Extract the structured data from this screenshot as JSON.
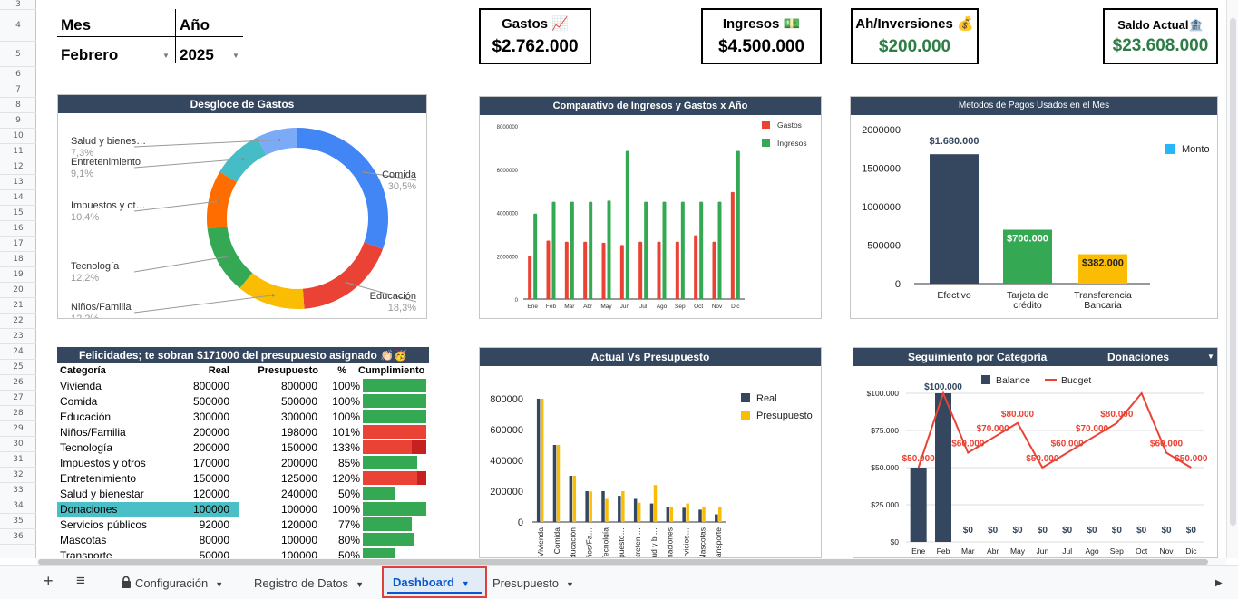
{
  "rows": [
    "3",
    "4",
    "5",
    "6",
    "7",
    "8",
    "9",
    "10",
    "11",
    "12",
    "13",
    "14",
    "15",
    "16",
    "17",
    "18",
    "19",
    "20",
    "21",
    "22",
    "23",
    "24",
    "25",
    "26",
    "27",
    "28",
    "29",
    "30",
    "31",
    "32",
    "33",
    "34",
    "35",
    "36"
  ],
  "filter": {
    "month_label": "Mes",
    "year_label": "Año",
    "month_value": "Febrero",
    "year_value": "2025"
  },
  "kpis": {
    "gastos": {
      "title": "Gastos 📈",
      "value": "$2.762.000"
    },
    "ingresos": {
      "title": "Ingresos 💵",
      "value": "$4.500.000"
    },
    "inversiones": {
      "title": "Ah/Inversiones 💰",
      "value": "$200.000"
    },
    "saldo": {
      "title": "Saldo Actual🏦",
      "value": "$23.608.000"
    }
  },
  "donut": {
    "title": "Desgloce de Gastos",
    "slices": [
      {
        "label": "Comida",
        "pct": "30,5%",
        "value": 30.5,
        "color": "#4285f4"
      },
      {
        "label": "Educación",
        "pct": "18,3%",
        "value": 18.3,
        "color": "#ea4335"
      },
      {
        "label": "Niños/Familia",
        "pct": "12,2%",
        "value": 12.2,
        "color": "#fbbc04"
      },
      {
        "label": "Tecnología",
        "pct": "12,2%",
        "value": 12.2,
        "color": "#34a853"
      },
      {
        "label": "Impuestos y ot…",
        "pct": "10,4%",
        "value": 10.4,
        "color": "#ff6d01"
      },
      {
        "label": "Entretenimiento",
        "pct": "9,1%",
        "value": 9.1,
        "color": "#46bdc6"
      },
      {
        "label": "Salud y bienes…",
        "pct": "7,3%",
        "value": 7.3,
        "color": "#7baaf7"
      }
    ]
  },
  "chart_data": [
    {
      "type": "bar",
      "title": "Comparativo de Ingresos y Gastos x Año",
      "categories": [
        "Ene",
        "Feb",
        "Mar",
        "Abr",
        "May",
        "Jun",
        "Jul",
        "Ago",
        "Sep",
        "Oct",
        "Nov",
        "Dic"
      ],
      "series": [
        {
          "name": "Gastos",
          "color": "#ea4335",
          "values": [
            2000000,
            2700000,
            2650000,
            2650000,
            2600000,
            2500000,
            2650000,
            2650000,
            2650000,
            2950000,
            2650000,
            4950000
          ]
        },
        {
          "name": "Ingresos",
          "color": "#34a853",
          "values": [
            3950000,
            4500000,
            4500000,
            4500000,
            4550000,
            6850000,
            4500000,
            4500000,
            4500000,
            4500000,
            4500000,
            6850000
          ]
        }
      ],
      "yticks": [
        "0",
        "2000000",
        "4000000",
        "6000000",
        "8000000"
      ],
      "ylim": [
        0,
        8000000
      ]
    },
    {
      "type": "bar",
      "title": "Metodos de Pagos Usados en el Mes",
      "categories": [
        "Efectivo",
        "Tarjeta de crédito",
        "Transferencia Bancaria"
      ],
      "cat_lines": [
        [
          "Efectivo"
        ],
        [
          "Tarjeta de",
          "crédito"
        ],
        [
          "Transferencia",
          "Bancaria"
        ]
      ],
      "series": [
        {
          "name": "Monto",
          "values": [
            1680000,
            700000,
            382000
          ]
        }
      ],
      "bar_colors": [
        "#34475e",
        "#34a853",
        "#fbbc04"
      ],
      "data_labels": [
        "$1.680.000",
        "$700.000",
        "$382.000"
      ],
      "yticks": [
        "0",
        "500000",
        "1000000",
        "1500000",
        "2000000"
      ],
      "ylim": [
        0,
        2000000
      ]
    },
    {
      "type": "bar",
      "title": "Actual Vs Presupuesto",
      "categories": [
        "Vivienda",
        "Comida",
        "Educación",
        "Niños/Fa…",
        "Tecnolgía",
        "Impuesto…",
        "Entreteni…",
        "Salud y bi…",
        "Donaciones",
        "Servicios…",
        "Mascotas",
        "Transporte"
      ],
      "series": [
        {
          "name": "Real",
          "color": "#34475e",
          "values": [
            800000,
            500000,
            300000,
            200000,
            200000,
            170000,
            150000,
            120000,
            100000,
            92000,
            80000,
            50000
          ]
        },
        {
          "name": "Presupuesto",
          "color": "#fbbc04",
          "values": [
            800000,
            500000,
            300000,
            198000,
            150000,
            200000,
            125000,
            240000,
            100000,
            120000,
            100000,
            100000
          ]
        }
      ],
      "yticks": [
        "0",
        "200000",
        "400000",
        "600000",
        "800000"
      ],
      "ylim": [
        0,
        800000
      ]
    },
    {
      "type": "bar",
      "title": "Seguimiento por Categoría",
      "category_filter": "Donaciones",
      "categories": [
        "Ene",
        "Feb",
        "Mar",
        "Abr",
        "May",
        "Jun",
        "Jul",
        "Ago",
        "Sep",
        "Oct",
        "Nov",
        "Dic"
      ],
      "series": [
        {
          "name": "Balance",
          "color": "#34475e",
          "values": [
            50000,
            100000,
            0,
            0,
            0,
            0,
            0,
            0,
            0,
            0,
            0,
            0
          ],
          "labels": [
            "",
            "$100.000",
            "$0",
            "$0",
            "$0",
            "$0",
            "$0",
            "$0",
            "$0",
            "$0",
            "$0",
            "$0"
          ]
        },
        {
          "name": "Budget",
          "color": "#ea4335",
          "type": "line",
          "values": [
            50000,
            100000,
            60000,
            70000,
            80000,
            50000,
            60000,
            70000,
            80000,
            100000,
            60000,
            50000
          ],
          "labels": [
            "$50.000",
            "",
            "$60.000",
            "$70.000",
            "$80.000",
            "$50.000",
            "$60.000",
            "$70.000",
            "$80.000",
            "",
            "$60.000",
            "$50.000"
          ]
        }
      ],
      "yticks": [
        "$0",
        "$25.000",
        "$50.000",
        "$75.000",
        "$100.000"
      ],
      "ylim": [
        0,
        100000
      ]
    }
  ],
  "budget": {
    "title": "Felicidades; te sobran $171000 del presupuesto asignado 👏🏻🥳",
    "headers": [
      "Categoría",
      "Real",
      "Presupuesto",
      "%",
      "Cumplimiento"
    ],
    "rows": [
      [
        "Vivienda",
        "800000",
        "800000",
        "100%",
        1.0
      ],
      [
        "Comida",
        "500000",
        "500000",
        "100%",
        1.0
      ],
      [
        "Educación",
        "300000",
        "300000",
        "100%",
        1.0
      ],
      [
        "Niños/Familia",
        "200000",
        "198000",
        "101%",
        1.01
      ],
      [
        "Tecnología",
        "200000",
        "150000",
        "133%",
        1.33
      ],
      [
        "Impuestos y otros",
        "170000",
        "200000",
        "85%",
        0.85
      ],
      [
        "Entretenimiento",
        "150000",
        "125000",
        "120%",
        1.2
      ],
      [
        "Salud y bienestar",
        "120000",
        "240000",
        "50%",
        0.5
      ],
      [
        "Donaciones",
        "100000",
        "100000",
        "100%",
        1.0
      ],
      [
        "Servicios públicos",
        "92000",
        "120000",
        "77%",
        0.77
      ],
      [
        "Mascotas",
        "80000",
        "100000",
        "80%",
        0.8
      ],
      [
        "Transporte",
        "50000",
        "100000",
        "50%",
        0.5
      ]
    ]
  },
  "tabs": {
    "add": "+",
    "menu": "≡",
    "items": [
      {
        "label": "Configuración",
        "locked": true
      },
      {
        "label": "Registro de Datos"
      },
      {
        "label": "Dashboard",
        "active": true
      },
      {
        "label": "Presupuesto"
      }
    ]
  }
}
